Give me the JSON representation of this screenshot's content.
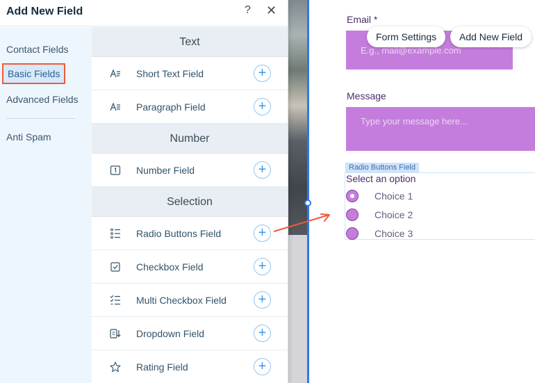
{
  "panel": {
    "title": "Add New Field",
    "help": "?",
    "close": "✕"
  },
  "sidebar": {
    "items": [
      {
        "label": "Contact Fields"
      },
      {
        "label": "Basic Fields"
      },
      {
        "label": "Advanced Fields"
      },
      {
        "label": "Anti Spam"
      }
    ]
  },
  "sections": [
    {
      "title": "Text",
      "fields": [
        {
          "label": "Short Text Field",
          "icon": "short-text-icon"
        },
        {
          "label": "Paragraph Field",
          "icon": "paragraph-icon"
        }
      ]
    },
    {
      "title": "Number",
      "fields": [
        {
          "label": "Number Field",
          "icon": "number-icon"
        }
      ]
    },
    {
      "title": "Selection",
      "fields": [
        {
          "label": "Radio Buttons Field",
          "icon": "radio-list-icon"
        },
        {
          "label": "Checkbox Field",
          "icon": "checkbox-icon"
        },
        {
          "label": "Multi Checkbox Field",
          "icon": "multi-checkbox-icon"
        },
        {
          "label": "Dropdown Field",
          "icon": "dropdown-icon"
        },
        {
          "label": "Rating Field",
          "icon": "star-icon"
        }
      ]
    }
  ],
  "add_glyph": "+",
  "toolbar": {
    "form_settings": "Form Settings",
    "add_new_field": "Add New Field"
  },
  "form": {
    "email_label": "Email *",
    "email_placeholder": "E.g., mail@example.com",
    "message_label": "Message",
    "message_placeholder": "Type your message here...",
    "radio_tag": "Radio Buttons Field",
    "select_title": "Select an option",
    "choices": [
      "Choice 1",
      "Choice 2",
      "Choice 3"
    ]
  },
  "colors": {
    "accent": "#3899ec",
    "highlight": "#f05a3c",
    "field_fill": "#c57ddd",
    "selection_line": "#2f78e8"
  }
}
